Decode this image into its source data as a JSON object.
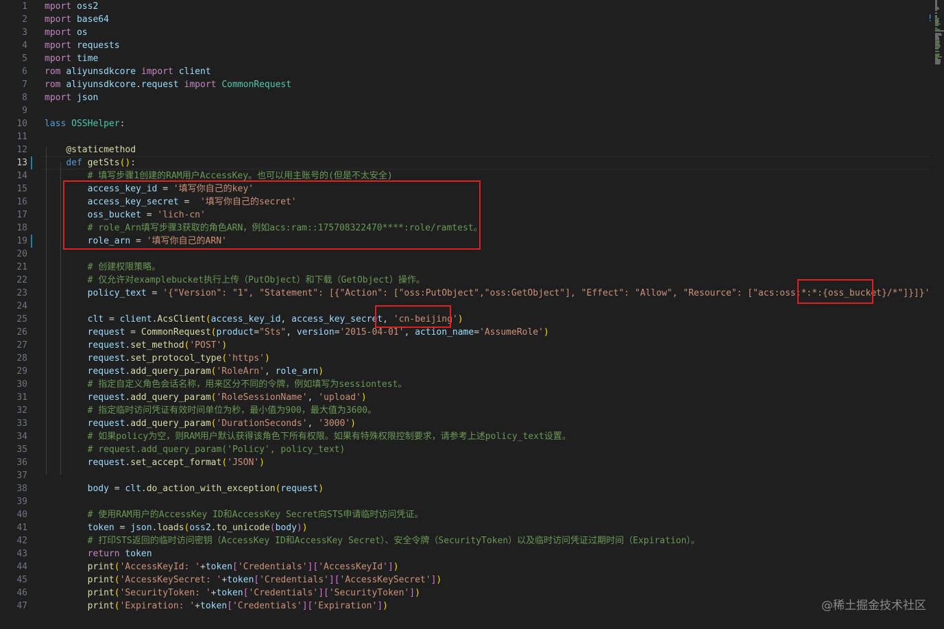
{
  "editor": {
    "language": "python",
    "active_line": 13,
    "line_numbers": [
      "1",
      "2",
      "3",
      "4",
      "5",
      "6",
      "7",
      "8",
      "9",
      "10",
      "11",
      "12",
      "13",
      "14",
      "15",
      "16",
      "17",
      "18",
      "19",
      "20",
      "21",
      "22",
      "23",
      "24",
      "25",
      "26",
      "27",
      "28",
      "29",
      "30",
      "31",
      "32",
      "33",
      "34",
      "35",
      "36",
      "37",
      "38",
      "39",
      "40",
      "41",
      "42",
      "43",
      "44",
      "45",
      "46",
      "47"
    ],
    "lines": [
      "mport oss2",
      "mport base64",
      "mport os",
      "mport requests",
      "mport time",
      "rom aliyunsdkcore import client",
      "rom aliyunsdkcore.request import CommonRequest",
      "mport json",
      "",
      "lass OSSHelper:",
      "",
      "    @staticmethod",
      "    def getSts():",
      "        # 填写步骤1创建的RAM用户AccessKey。也可以用主账号的(但是不太安全)",
      "        access_key_id = '填写你自己的key'",
      "        access_key_secret =  '填写你自己的secret'",
      "        oss_bucket = 'lich-cn'",
      "        # role_Arn填写步骤3获取的角色ARN，例如acs:ram::175708322470****:role/ramtest。",
      "        role_arn = '填写你自己的ARN'",
      "",
      "        # 创建权限策略。",
      "        # 仅允许对examplebucket执行上传（PutObject）和下载（GetObject）操作。",
      "        policy_text = '{\"Version\": \"1\", \"Statement\": [{\"Action\": [\"oss:PutObject\",\"oss:GetObject\"], \"Effect\": \"Allow\", \"Resource\": [\"acs:oss:*:*:{oss_bucket}/*\"]}]}'",
      "",
      "        clt = client.AcsClient(access_key_id, access_key_secret, 'cn-beijing')",
      "        request = CommonRequest(product=\"Sts\", version='2015-04-01', action_name='AssumeRole')",
      "        request.set_method('POST')",
      "        request.set_protocol_type('https')",
      "        request.add_query_param('RoleArn', role_arn)",
      "        # 指定自定义角色会话名称，用来区分不同的令牌，例如填写为sessiontest。",
      "        request.add_query_param('RoleSessionName', 'upload')",
      "        # 指定临时访问凭证有效时间单位为秒，最小值为900，最大值为3600。",
      "        request.add_query_param('DurationSeconds', '3000')",
      "        # 如果policy为空，则RAM用户默认获得该角色下所有权限。如果有特殊权限控制要求，请参考上述policy_text设置。",
      "        # request.add_query_param('Policy', policy_text)",
      "        request.set_accept_format('JSON')",
      "",
      "        body = clt.do_action_with_exception(request)",
      "",
      "        # 使用RAM用户的AccessKey ID和AccessKey Secret向STS申请临时访问凭证。",
      "        token = json.loads(oss2.to_unicode(body))",
      "        # 打印STS返回的临时访问密钥（AccessKey ID和AccessKey Secret）、安全令牌（SecurityToken）以及临时访问凭证过期时间（Expiration）。",
      "        return token",
      "        print('AccessKeyId: '+token['Credentials']['AccessKeyId'])",
      "        print('AccessKeySecret: '+token['Credentials']['AccessKeySecret'])",
      "        print('SecurityToken: '+token['Credentials']['SecurityToken'])",
      "        print('Expiration: '+token['Credentials']['Expiration'])"
    ]
  },
  "watermark": "@稀土掘金技术社区",
  "colors": {
    "background": "#1f1f1f",
    "highlight_box": "#e02222",
    "keyword": "#569cd6",
    "control": "#c586c0",
    "variable": "#9cdcfe",
    "function": "#dcdcaa",
    "string": "#ce9178",
    "comment": "#6a9955",
    "class": "#4ec9b0"
  }
}
